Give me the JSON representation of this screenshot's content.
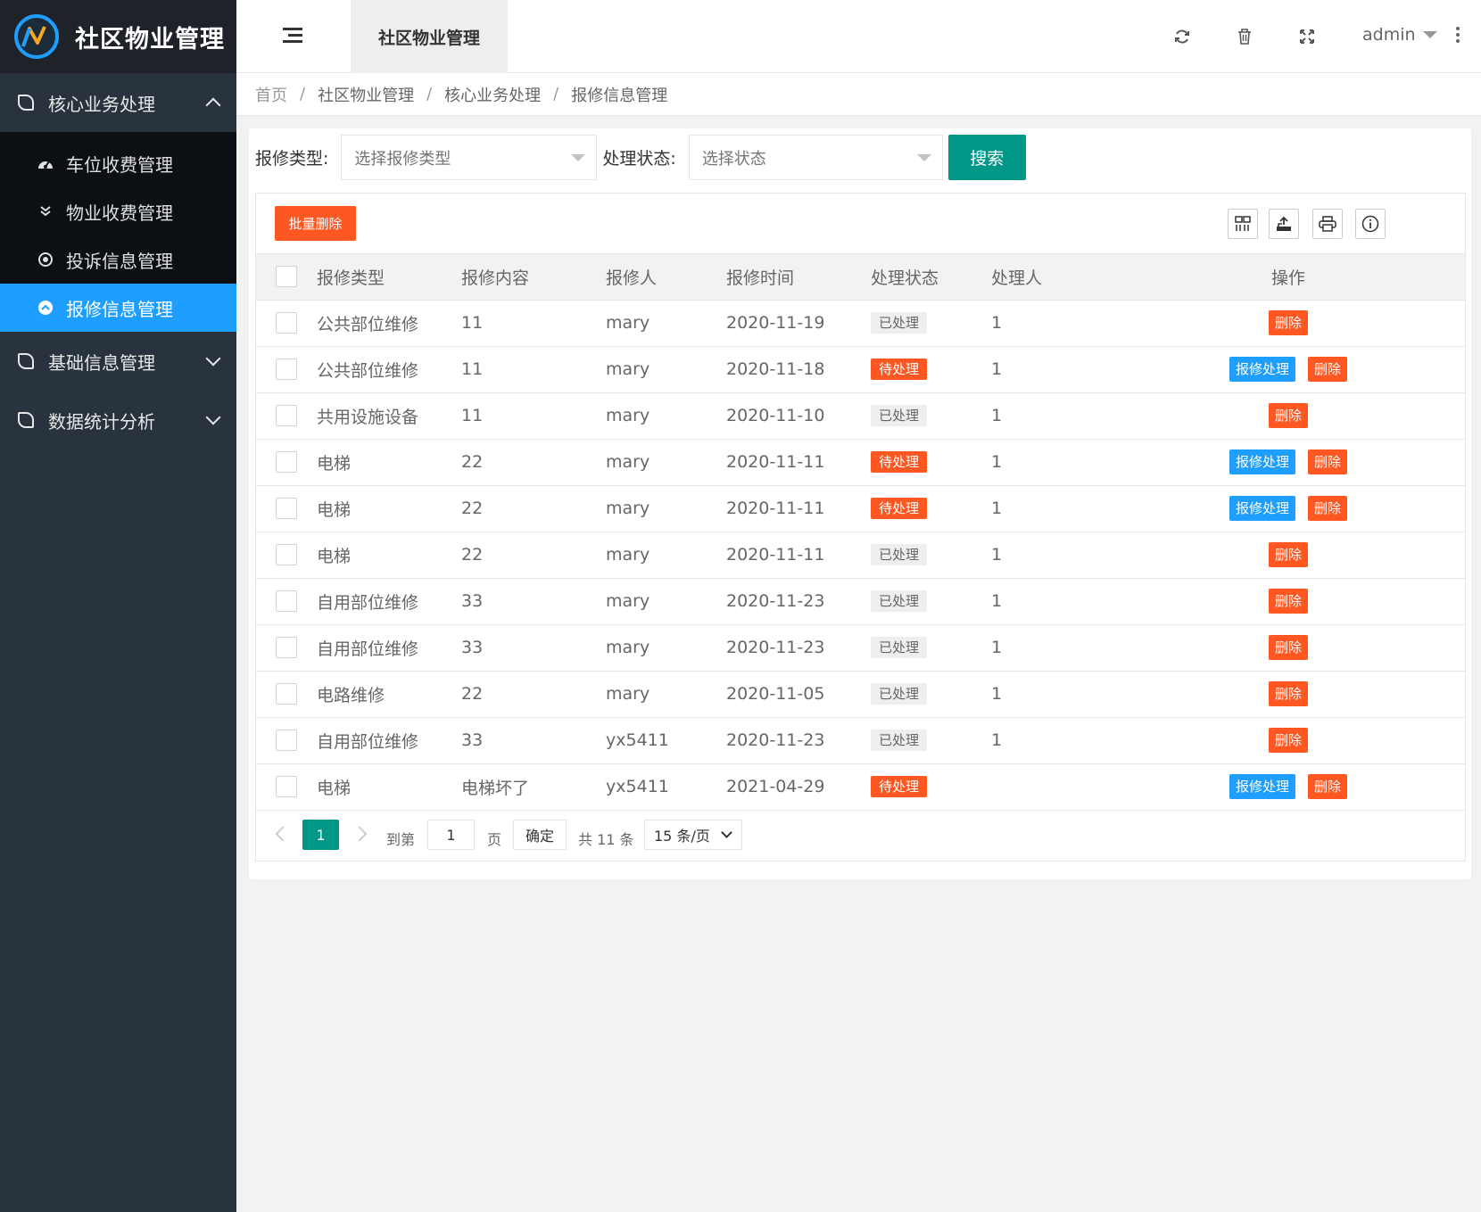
{
  "app": {
    "title": "社区物业管理"
  },
  "sidebar": {
    "groups": [
      {
        "label": "核心业务处理",
        "expanded": true
      },
      {
        "label": "基础信息管理",
        "expanded": false
      },
      {
        "label": "数据统计分析",
        "expanded": false
      }
    ],
    "subitems": [
      {
        "label": "车位收费管理",
        "icon": "dashboard-icon"
      },
      {
        "label": "物业收费管理",
        "icon": "double-chevron-down-icon"
      },
      {
        "label": "投诉信息管理",
        "icon": "target-icon"
      },
      {
        "label": "报修信息管理",
        "icon": "chevron-up-circle-icon",
        "active": true
      }
    ]
  },
  "header": {
    "tab": "社区物业管理",
    "user": "admin"
  },
  "breadcrumb": [
    "首页",
    "社区物业管理",
    "核心业务处理",
    "报修信息管理"
  ],
  "filter": {
    "type_label": "报修类型:",
    "type_placeholder": "选择报修类型",
    "status_label": "处理状态:",
    "status_placeholder": "选择状态",
    "search_label": "搜索"
  },
  "toolbar": {
    "batch_delete": "批量删除"
  },
  "table": {
    "headers": [
      "报修类型",
      "报修内容",
      "报修人",
      "报修时间",
      "处理状态",
      "处理人",
      "操作"
    ],
    "rows": [
      {
        "type": "公共部位维修",
        "content": "11",
        "reporter": "mary",
        "time": "2020-11-19",
        "status": "已处理",
        "handler": "1"
      },
      {
        "type": "公共部位维修",
        "content": "11",
        "reporter": "mary",
        "time": "2020-11-18",
        "status": "待处理",
        "handler": "1"
      },
      {
        "type": "共用设施设备",
        "content": "11",
        "reporter": "mary",
        "time": "2020-11-10",
        "status": "已处理",
        "handler": "1"
      },
      {
        "type": "电梯",
        "content": "22",
        "reporter": "mary",
        "time": "2020-11-11",
        "status": "待处理",
        "handler": "1"
      },
      {
        "type": "电梯",
        "content": "22",
        "reporter": "mary",
        "time": "2020-11-11",
        "status": "待处理",
        "handler": "1"
      },
      {
        "type": "电梯",
        "content": "22",
        "reporter": "mary",
        "time": "2020-11-11",
        "status": "已处理",
        "handler": "1"
      },
      {
        "type": "自用部位维修",
        "content": "33",
        "reporter": "mary",
        "time": "2020-11-23",
        "status": "已处理",
        "handler": "1"
      },
      {
        "type": "自用部位维修",
        "content": "33",
        "reporter": "mary",
        "time": "2020-11-23",
        "status": "已处理",
        "handler": "1"
      },
      {
        "type": "电路维修",
        "content": "22",
        "reporter": "mary",
        "time": "2020-11-05",
        "status": "已处理",
        "handler": "1"
      },
      {
        "type": "自用部位维修",
        "content": "33",
        "reporter": "yx5411",
        "time": "2020-11-23",
        "status": "已处理",
        "handler": "1"
      },
      {
        "type": "电梯",
        "content": "电梯坏了",
        "reporter": "yx5411",
        "time": "2021-04-29",
        "status": "待处理",
        "handler": ""
      }
    ],
    "action_process": "报修处理",
    "action_delete": "删除",
    "pending_value": "待处理"
  },
  "pager": {
    "current": "1",
    "goto_label": "到第",
    "goto_value": "1",
    "page_label": "页",
    "confirm": "确定",
    "total": "共 11 条",
    "page_size": "15 条/页"
  },
  "colors": {
    "primary": "#009688",
    "blue": "#1e9fff",
    "danger": "#ff5722",
    "sidebar": "#28333e"
  }
}
